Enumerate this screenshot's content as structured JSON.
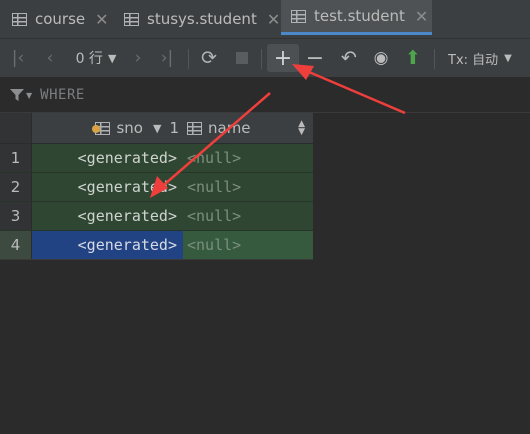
{
  "tabs": [
    {
      "label": "course",
      "active": false
    },
    {
      "label": "stusys.student",
      "active": false
    },
    {
      "label": "test.student",
      "active": true
    }
  ],
  "toolbar": {
    "row_count": "0 行",
    "tx_label": "Tx: 自动",
    "icons": [
      "first-page-icon",
      "prev-page-icon",
      "next-page-icon",
      "last-page-icon",
      "refresh-icon",
      "stop-icon",
      "add-row-icon",
      "delete-row-icon",
      "revert-icon",
      "preview-icon",
      "submit-icon"
    ]
  },
  "filter": {
    "label": "WHERE"
  },
  "grid": {
    "columns": [
      {
        "name": "sno",
        "sort": "1"
      },
      {
        "name": "name"
      }
    ],
    "rows": [
      {
        "num": "1",
        "sno": "<generated>",
        "name": "<null>"
      },
      {
        "num": "2",
        "sno": "<generated>",
        "name": "<null>"
      },
      {
        "num": "3",
        "sno": "<generated>",
        "name": "<null>"
      },
      {
        "num": "4",
        "sno": "<generated>",
        "name": "<null>"
      }
    ]
  },
  "colors": {
    "accent": "#4a88c7",
    "new_row": "#2f4632",
    "selected": "#214283",
    "arrow": "#ef3f3c"
  }
}
